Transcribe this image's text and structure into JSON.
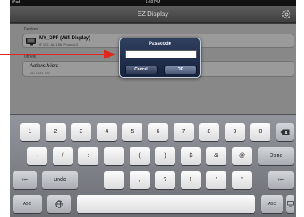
{
  "status_bar": {
    "left": "iPad",
    "time": "1:03 PM",
    "right": ""
  },
  "nav": {
    "title": "EZ Display"
  },
  "devices": {
    "section_label": "Devices",
    "items": [
      {
        "title": "MY_DPF (Wifi Display)",
        "subtitle": "IP 192.168.1.56, Protocol:2"
      }
    ]
  },
  "others": {
    "section_label": "Others",
    "items": [
      {
        "title": "Actions Micro",
        "subtitle": "192.168.1.100"
      }
    ]
  },
  "dialog": {
    "title": "Passcode",
    "field_value": "",
    "cancel_label": "Cancel",
    "ok_label": "OK"
  },
  "keyboard": {
    "row1": [
      "1",
      "2",
      "3",
      "4",
      "5",
      "6",
      "7",
      "8",
      "9",
      "0"
    ],
    "row2": [
      "-",
      "/",
      ":",
      ";",
      "(",
      ")",
      "$",
      "&",
      "@"
    ],
    "return_label": "Done",
    "row3_left_mod": "#+=",
    "undo_label": "undo",
    "row3": [
      ".",
      ",",
      "?",
      "!",
      "'",
      "\""
    ],
    "row3_right_mod": "#+=",
    "abc_left": "ABC",
    "abc_right": "ABC"
  },
  "colors": {
    "annotation_arrow": "#e0261d",
    "keyboard_bg": "#82848a",
    "dialog_bg": "#22304c"
  }
}
